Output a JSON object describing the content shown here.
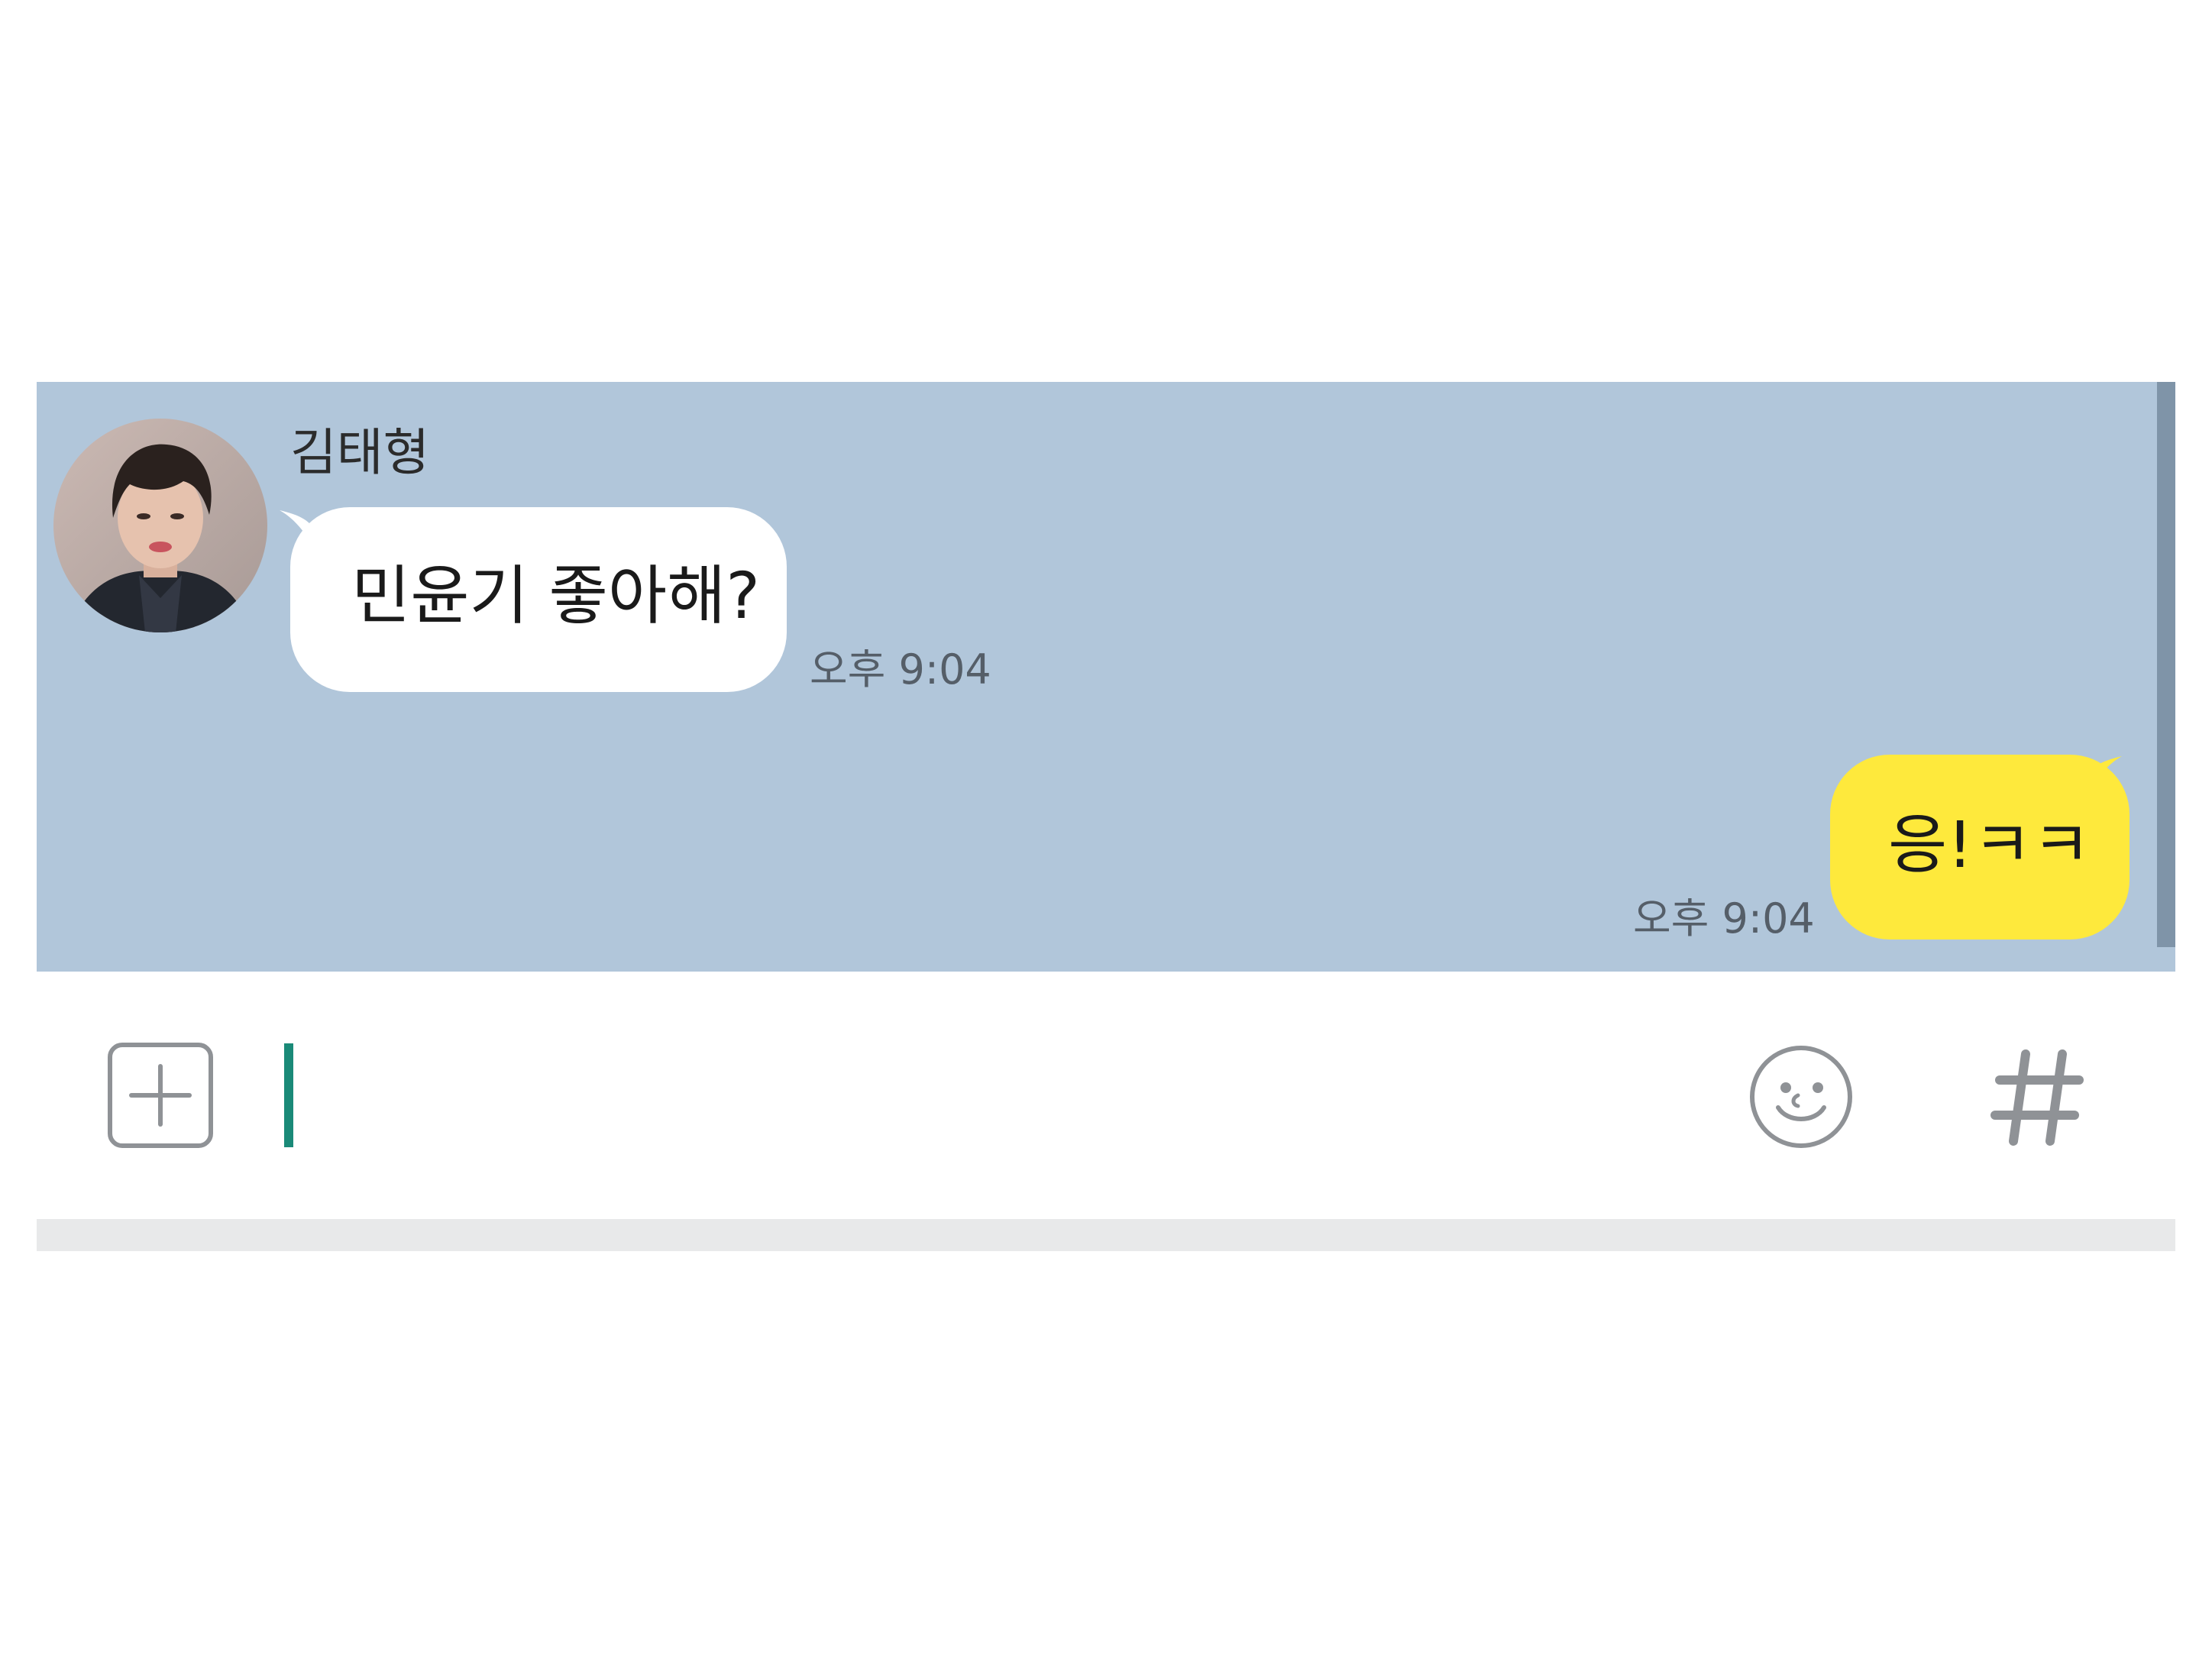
{
  "chat": {
    "background_color": "#b1c6da",
    "incoming": {
      "sender_name": "김태형",
      "message": "민윤기 좋아해?",
      "time": "오후 9:04",
      "bubble_color": "#ffffff"
    },
    "outgoing": {
      "message": "응!ㅋㅋ",
      "time": "오후 9:04",
      "bubble_color": "#fee93c"
    }
  },
  "input_bar": {
    "attach_icon": "plus-square-icon",
    "input_value": "",
    "emoji_icon": "smiley-icon",
    "hash_icon": "hash-icon",
    "caret_color": "#1a8a78"
  }
}
